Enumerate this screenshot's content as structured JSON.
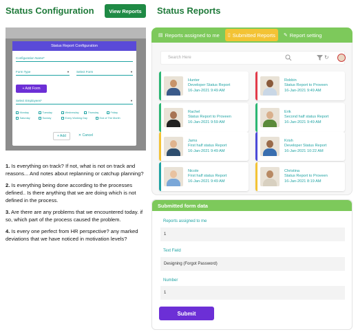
{
  "left": {
    "heading": "Status Configuration",
    "view_button": "View Reports",
    "modal": {
      "title": "Status Report Configuration",
      "config_name_placeholder": "Configuration Name*",
      "form_type_placeholder": "Form Type",
      "select_form_placeholder": "Select Form",
      "add_form_label": "+ Add Form",
      "employees_placeholder": "Select Employees*",
      "days": [
        "Monday",
        "Tuesday",
        "Wednesday",
        "Thursday",
        "Friday",
        "Saturday",
        "Sunday",
        "Every Working Day",
        "End of The Month"
      ],
      "add_label": "+ Add",
      "cancel_label": "✕ Cancel"
    },
    "questions": [
      {
        "num": "1.",
        "text": "Is everything on track? If not, what is not on track and reasons... And notes about replanning or catchup planning?"
      },
      {
        "num": "2.",
        "text": "Is everything being done according to the processes defined.. Is there anything that we are doing which is not defined in the process."
      },
      {
        "num": "3.",
        "text": "Are there are any problems that we encountered today. if so, which part of the process caused the problem."
      },
      {
        "num": "4.",
        "text": "Is every one perfect from HR perspective? any marked deviations that we have noticed in motivation levels?"
      }
    ]
  },
  "right": {
    "heading": "Status Reports",
    "tabs": [
      {
        "label": "Reports assigned to me",
        "icon": "clipboard-icon",
        "active": false
      },
      {
        "label": "Submitted Reports",
        "icon": "document-icon",
        "active": true
      },
      {
        "label": "Report setting",
        "icon": "edit-icon",
        "active": false
      }
    ],
    "search_placeholder": "Search Here",
    "reports": [
      {
        "name": "Hunter",
        "title": "Developer Status Report",
        "date": "16-Jan-2021 9:49 AM",
        "accent": "#2bb673",
        "skin": "#c8946a",
        "shirt": "#3a5a8a"
      },
      {
        "name": "Robbin",
        "title": "Status Report to Proveen",
        "date": "16-Jan-2021 9:49 AM",
        "accent": "#e23b4a",
        "skin": "#8a5a3a",
        "shirt": "#c9d7e6"
      },
      {
        "name": "Rachel",
        "title": "Status Report to Proveen",
        "date": "16-Jan-2021 9:59 AM",
        "accent": "#2bb673",
        "skin": "#a87454",
        "shirt": "#222222"
      },
      {
        "name": "Erik",
        "title": "Second half status Report",
        "date": "16-Jan-2021 9:49 AM",
        "accent": "#2bb673",
        "skin": "#d9b08c",
        "shirt": "#5b8a3a"
      },
      {
        "name": "Jams",
        "title": "First half status Report",
        "date": "16-Jan-2021 9:49 AM",
        "accent": "#f3c335",
        "skin": "#e0b48e",
        "shirt": "#2f4f6f"
      },
      {
        "name": "Krish",
        "title": "Developer Status Report",
        "date": "16-Jan-2021 10:22 AM",
        "accent": "#4a4ad8",
        "skin": "#9a6b4a",
        "shirt": "#3a6fb0"
      },
      {
        "name": "Nicole",
        "title": "First half status Report",
        "date": "16-Jan-2021 9:49 AM",
        "accent": "#1fa3a3",
        "skin": "#e8c2a0",
        "shirt": "#7aa7d8"
      },
      {
        "name": "Christina",
        "title": "Status Report to Proveen",
        "date": "16-Jan-2021 8:19 AM",
        "accent": "#f3c335",
        "skin": "#b88a64",
        "shirt": "#d8d0c0"
      }
    ],
    "form": {
      "heading": "Submitted form data",
      "fields": [
        {
          "label": "Reports assigned to me",
          "value": "1"
        },
        {
          "label": "Text Field",
          "value": "Designing (Forgot Password)"
        },
        {
          "label": "Number",
          "value": "1"
        }
      ],
      "submit_label": "Submit"
    }
  }
}
